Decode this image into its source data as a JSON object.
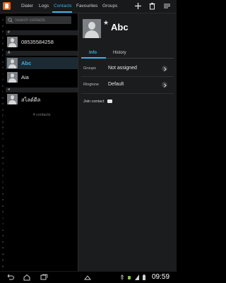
{
  "tabs": [
    "Dialer",
    "Logs",
    "Contacts",
    "Favourites",
    "Groups"
  ],
  "search": {
    "placeholder": "Search contacts"
  },
  "index_letters": [
    "#",
    "A",
    "B",
    "C",
    "D",
    "E",
    "F",
    "G",
    "H",
    "I",
    "J",
    "K",
    "L",
    "M",
    "N",
    "O",
    "P",
    "Q",
    "R",
    "S",
    "T",
    "U",
    "V",
    "W",
    "X",
    "Y",
    "Z",
    "ก",
    "ข",
    "ฃ",
    "ค",
    "ฅ",
    "ฆ",
    "ง",
    "จ",
    "ฉ",
    "ช",
    "ซ",
    "ฌ",
    "ญ",
    "ฎ",
    "ฏ"
  ],
  "sections": [
    {
      "header": "#",
      "contacts": [
        "08535584258"
      ]
    },
    {
      "header": "A",
      "contacts": [
        "Abc",
        "Aia"
      ]
    },
    {
      "header": "ส",
      "contacts": [
        "สไลด์ดีล"
      ]
    }
  ],
  "contact_count": "4 contacts",
  "detail": {
    "name": "Abc",
    "tabs": [
      "Info",
      "History"
    ],
    "groups_label": "Groups",
    "groups_value": "Not assigned",
    "ringtone_label": "Ringtone",
    "ringtone_value": "Default",
    "join_label": "Join contact"
  },
  "status": {
    "time": "09:59"
  },
  "colors": {
    "accent": "#3ab1e6",
    "app_icon": "#e8631c"
  }
}
